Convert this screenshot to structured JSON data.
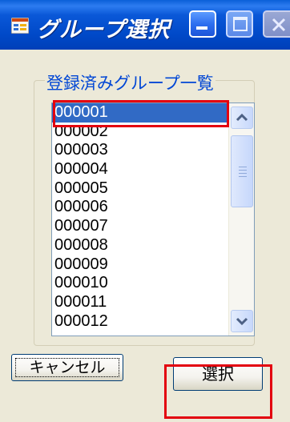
{
  "window": {
    "title": "グループ選択",
    "icons": {
      "app": "form-window-icon",
      "minimize": "minimize-icon",
      "maximize": "maximize-icon",
      "close": "close-icon"
    }
  },
  "group": {
    "legend": "登録済みグループ一覧",
    "items": [
      "000001",
      "000002",
      "000003",
      "000004",
      "000005",
      "000006",
      "000007",
      "000008",
      "000009",
      "000010",
      "000011",
      "000012"
    ],
    "selected_index": 0
  },
  "buttons": {
    "cancel_label": "キャンセル",
    "select_label": "選択"
  },
  "colors": {
    "titlebar": "#0049c8",
    "selection": "#316ac5",
    "legend_text": "#0046d5",
    "annotation": "#e3000f"
  }
}
